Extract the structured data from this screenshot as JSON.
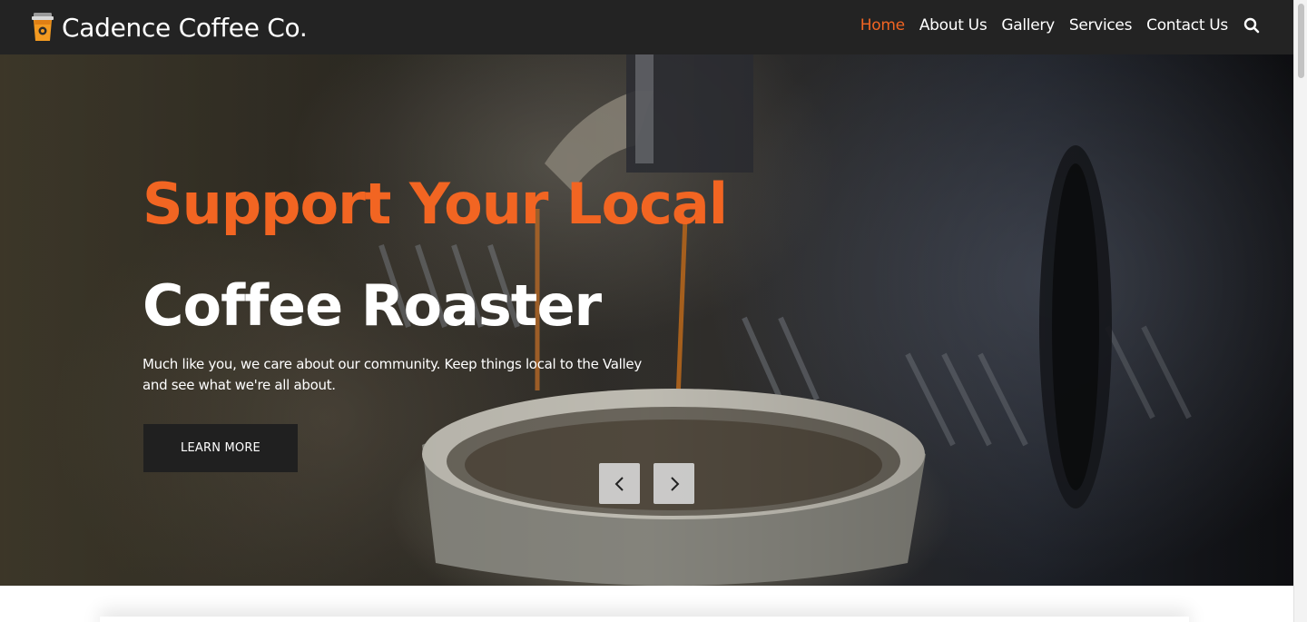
{
  "brand": {
    "name": "Cadence Coffee Co.",
    "icon": "coffee-cup-icon",
    "accent_color": "#f26522"
  },
  "nav": {
    "items": [
      {
        "label": "Home",
        "active": true
      },
      {
        "label": "About Us",
        "active": false
      },
      {
        "label": "Gallery",
        "active": false
      },
      {
        "label": "Services",
        "active": false
      },
      {
        "label": "Contact Us",
        "active": false
      }
    ],
    "search_icon": "search-icon"
  },
  "hero": {
    "headline_line1": "Support Your Local",
    "headline_line2": "Coffee Roaster",
    "description": "Much like you, we care about our community. Keep things local to the Valley and see what we're all about.",
    "cta_label": "LEARN MORE",
    "prev_icon": "chevron-left-icon",
    "next_icon": "chevron-right-icon",
    "background_image": "espresso-machine-pouring-coffee"
  },
  "colors": {
    "header_bg": "#232323",
    "button_bg": "#202020",
    "text_light": "#ffffff"
  }
}
